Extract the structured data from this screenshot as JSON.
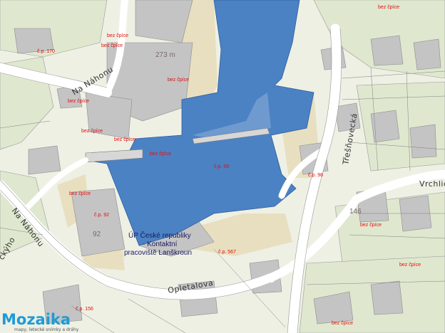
{
  "streets": {
    "na_nahonu_top": "Na Náhonu",
    "na_nahonu_left": "Na Náhonu",
    "opletalova": "Opletalova",
    "tresnovecka": "Třešňovecká",
    "vrchlickeho": "Vrchlick",
    "paleckeho": "ckýho"
  },
  "labels": {
    "bez_cpice": "bez čpíce",
    "cp_99": "č.p. 99",
    "cp_92": "č.p. 92",
    "cp_98": "č.p. 98",
    "cp_567": "č.p. 567",
    "cp_156": "č.p. 156",
    "cp_170": "č.p. 170",
    "cp_92_num": "92",
    "cp_146_num": "146",
    "height": "273 m",
    "office_line1": "ÚP České republiky",
    "office_line2": "- Kontaktní",
    "office_line3": "pracoviště Lanškroun"
  },
  "logo": {
    "brand": "Mozaika",
    "tagline": "mapy, letecké snímky a dráhy"
  },
  "colors": {
    "water": "#4b82c4",
    "building_gray": "#c4c4c4",
    "road_white": "#ffffff",
    "background": "#eef0e4",
    "label_red": "#e01010"
  }
}
